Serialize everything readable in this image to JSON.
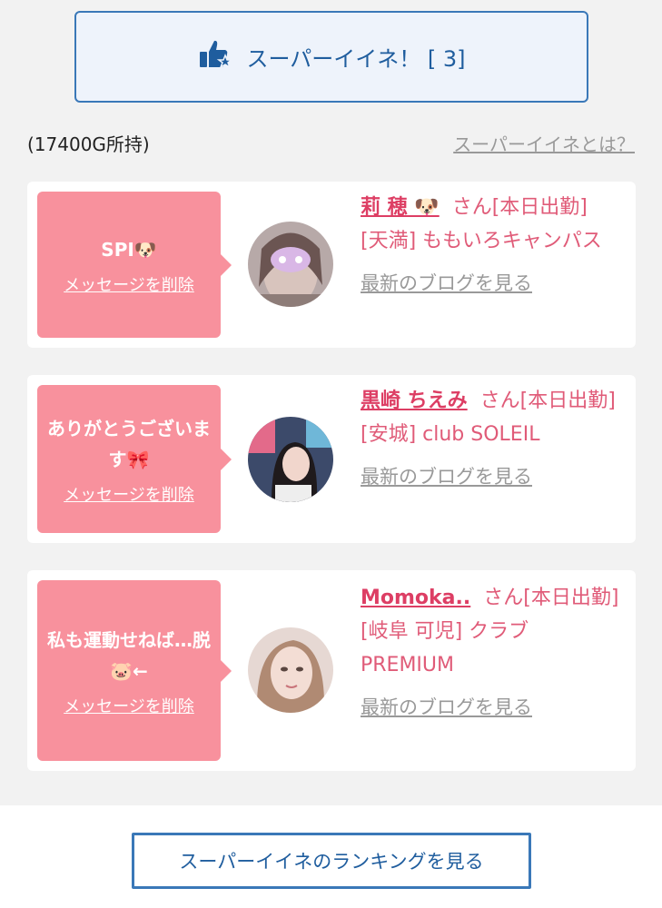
{
  "super_like": {
    "label": "スーパーイイネ！ [ 3]",
    "icon": "thumbs-up-star-icon"
  },
  "coins": "(17400G所持)",
  "what_link": "スーパーイイネとは？",
  "cards": [
    {
      "message": "SPI🐶",
      "delete_label": "メッセージを削除",
      "name": "莉 穂 🐶",
      "suffix": "さん[本日出勤]",
      "shop": "[天満] ももいろキャンパス",
      "blog_label": "最新のブログを見る"
    },
    {
      "message": "ありがとうございます🎀",
      "delete_label": "メッセージを削除",
      "name": "黒崎 ちえみ",
      "suffix": "さん[本日出勤]",
      "shop": "[安城] club SOLEIL",
      "blog_label": "最新のブログを見る"
    },
    {
      "message": "私も運動せねば…脱🐷←",
      "delete_label": "メッセージを削除",
      "name": "Momoka..",
      "suffix": "さん[本日出勤]",
      "shop": "[岐阜 可児] クラブPREMIUM",
      "blog_label": "最新のブログを見る"
    }
  ],
  "ranking_button": "スーパーイイネのランキングを見る",
  "colors": {
    "accent": "#3a78b8",
    "pink": "#f8919d",
    "name": "#dd3e64"
  }
}
